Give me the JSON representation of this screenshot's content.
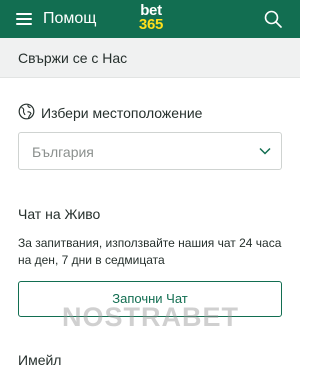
{
  "colors": {
    "brand_green": "#126e51",
    "logo_yellow": "#ffdf1b",
    "subheader_bg": "#f0f1f1",
    "text": "#26302d",
    "placeholder": "#8b908e"
  },
  "topbar": {
    "title": "Помощ",
    "logo": {
      "top": "bet",
      "bottom": "365"
    },
    "menu_icon": "hamburger-menu-icon",
    "search_icon": "search-icon"
  },
  "subheader": {
    "title": "Свържи се с Нас"
  },
  "location": {
    "icon": "globe-icon",
    "label": "Избери местоположение",
    "selected": "България"
  },
  "live_chat": {
    "title": "Чат на Живо",
    "description": "За запитвания, използвайте нашия чат 24 часа на ден, 7 дни в седмицата",
    "button_label": "Започни Чат"
  },
  "watermark": "NOSTRABET",
  "email": {
    "title": "Имейл"
  }
}
